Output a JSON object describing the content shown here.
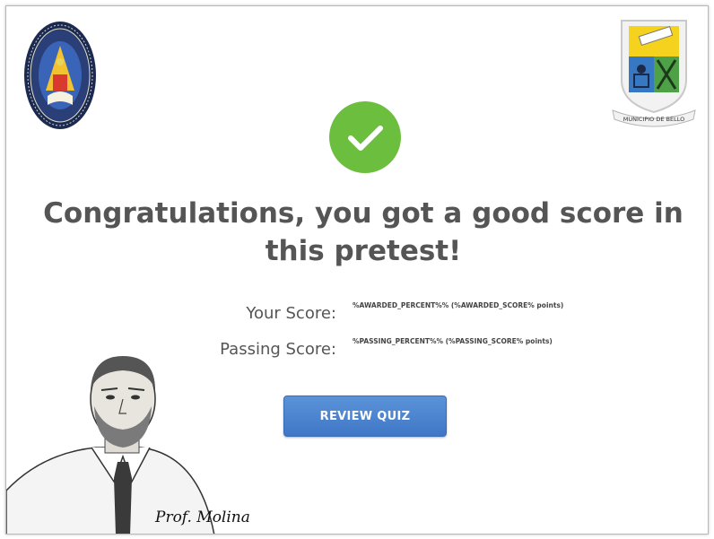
{
  "headline": {
    "line1": "Congratulations, you got a good score in",
    "line2": "this pretest!"
  },
  "scores": {
    "your_score_label": "Your Score:",
    "your_score_value": "%AWARDED_PERCENT%% (%AWARDED_SCORE% points)",
    "passing_score_label": "Passing Score:",
    "passing_score_value": "%PASSING_PERCENT%% (%PASSING_SCORE% points)"
  },
  "review_button": {
    "label": "REVIEW QUIZ"
  },
  "right_logo": {
    "caption": "MUNICIPIO DE BELLO"
  },
  "signature": {
    "text": "Prof. Molina"
  },
  "colors": {
    "success_green": "#6cbf3e",
    "button_blue": "#4a82cf",
    "headline_gray": "#555555"
  },
  "icons": {
    "success": "check-circle-icon",
    "school_seal": "school-seal-logo",
    "municipal_shield": "municipal-shield-logo"
  }
}
